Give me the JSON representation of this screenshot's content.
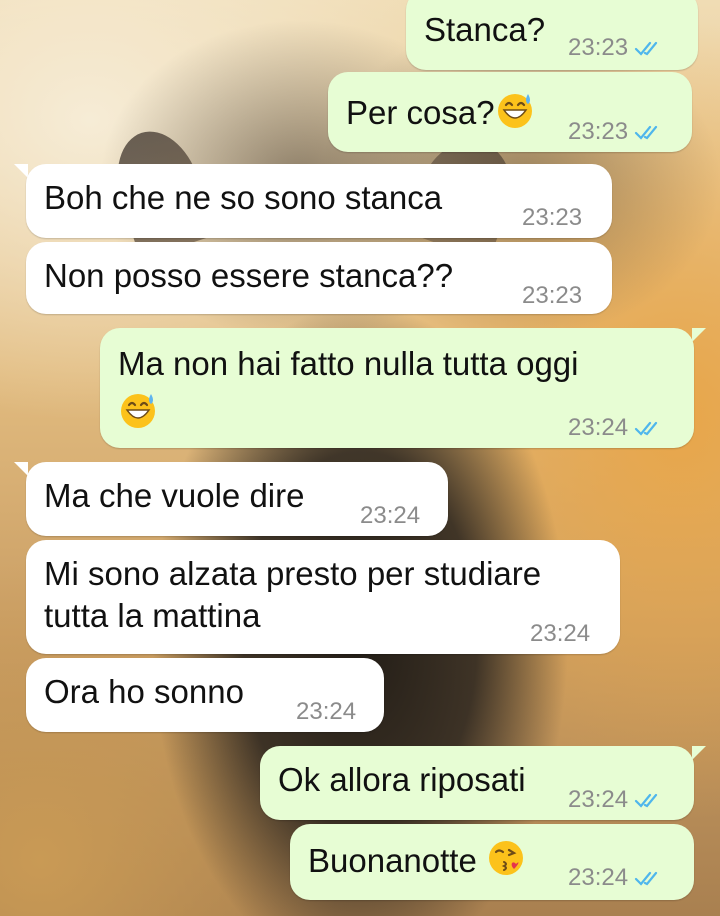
{
  "messages": [
    {
      "id": "m1",
      "dir": "out",
      "text": "Stanca?",
      "time": "23:23",
      "status": "read"
    },
    {
      "id": "m2",
      "dir": "out",
      "text": "Per cosa?",
      "emoji": "grinning-sweat-emoji",
      "time": "23:23",
      "status": "read"
    },
    {
      "id": "m3",
      "dir": "in",
      "text": "Boh che ne so sono stanca",
      "time": "23:23"
    },
    {
      "id": "m4",
      "dir": "in",
      "text": "Non posso essere stanca??",
      "time": "23:23"
    },
    {
      "id": "m5",
      "dir": "out",
      "text": "Ma non hai fatto nulla tutta oggi",
      "emoji": "grinning-sweat-emoji",
      "time": "23:24",
      "status": "read"
    },
    {
      "id": "m6",
      "dir": "in",
      "text": "Ma che vuole dire",
      "time": "23:24"
    },
    {
      "id": "m7",
      "dir": "in",
      "line1": "Mi sono alzata presto per studiare",
      "line2": "tutta la mattina",
      "time": "23:24"
    },
    {
      "id": "m8",
      "dir": "in",
      "text": "Ora ho sonno",
      "time": "23:24"
    },
    {
      "id": "m9",
      "dir": "out",
      "text": "Ok allora riposati",
      "time": "23:24",
      "status": "read"
    },
    {
      "id": "m10",
      "dir": "out",
      "text": "Buonanotte",
      "emoji": "kissing-heart-emoji",
      "time": "23:24",
      "status": "read"
    }
  ],
  "colors": {
    "outgoing_bubble": "#e7fdd4",
    "incoming_bubble": "#ffffff",
    "read_ticks": "#4fb6ec",
    "timestamp": "#8b8b8b"
  }
}
